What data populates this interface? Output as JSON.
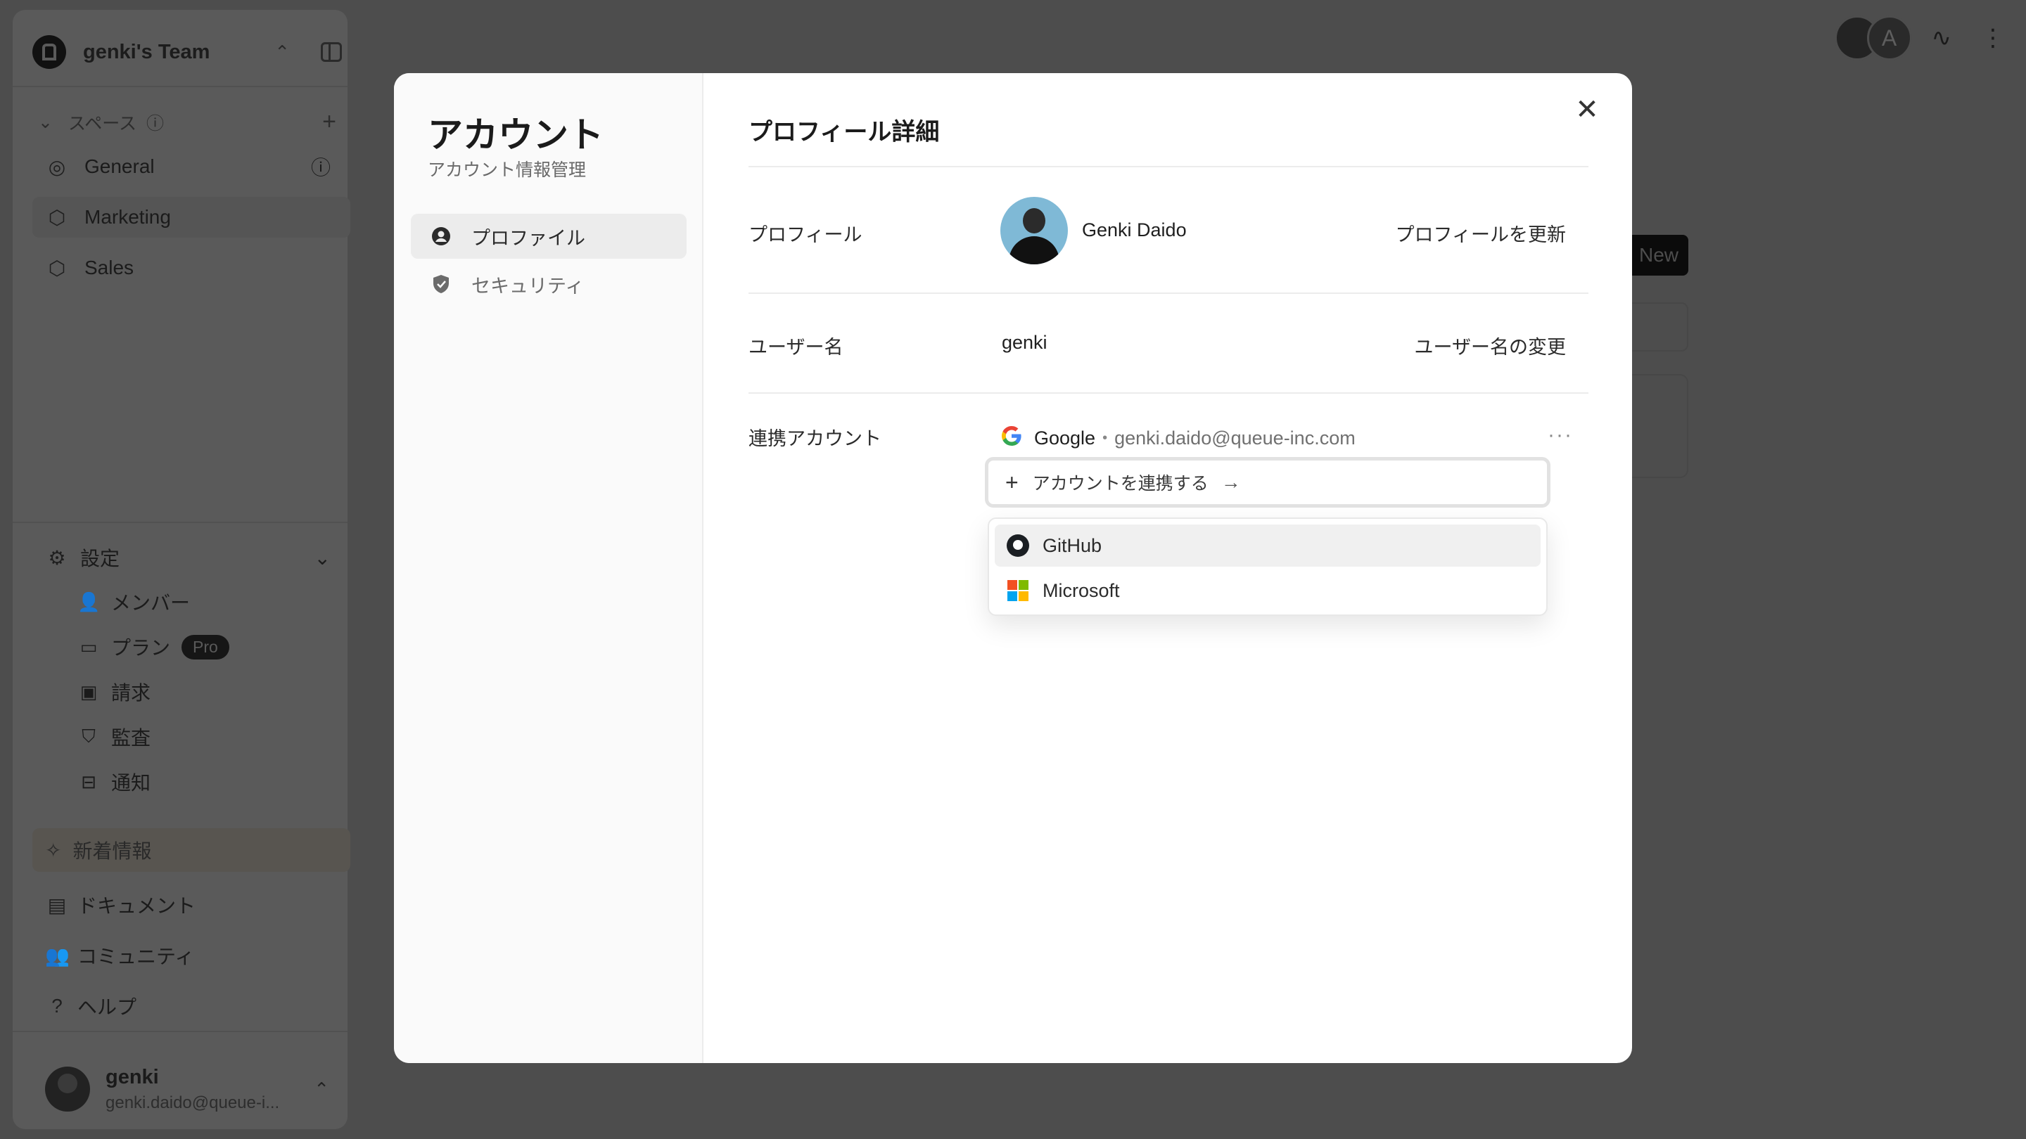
{
  "sidebar": {
    "team_name": "genki's Team",
    "spaces_label": "スペース",
    "spaces": [
      {
        "label": "General",
        "icon": "globe-icon"
      },
      {
        "label": "Marketing",
        "icon": "cube-icon",
        "active": true
      },
      {
        "label": "Sales",
        "icon": "cube-icon"
      }
    ],
    "settings_label": "設定",
    "settings_items": [
      {
        "label": "メンバー",
        "icon": "user-plus-icon"
      },
      {
        "label": "プラン",
        "icon": "wallet-icon",
        "badge": "Pro"
      },
      {
        "label": "請求",
        "icon": "banknote-icon"
      },
      {
        "label": "監査",
        "icon": "shield-icon"
      },
      {
        "label": "通知",
        "icon": "inbox-icon"
      }
    ],
    "whats_new": "新着情報",
    "links": [
      {
        "label": "ドキュメント",
        "icon": "document-icon"
      },
      {
        "label": "コミュニティ",
        "icon": "users-icon"
      },
      {
        "label": "ヘルプ",
        "icon": "help-icon"
      }
    ],
    "user": {
      "name": "genki",
      "email": "genki.daido@queue-i..."
    }
  },
  "topbar": {
    "avatar_letter": "A"
  },
  "background": {
    "new_button": "New"
  },
  "modal": {
    "title": "アカウント",
    "subtitle": "アカウント情報管理",
    "tabs": [
      {
        "label": "プロファイル",
        "icon": "user-circle-icon",
        "active": true
      },
      {
        "label": "セキュリティ",
        "icon": "shield-check-icon",
        "active": false
      }
    ],
    "section_title": "プロフィール詳細",
    "profile": {
      "label": "プロフィール",
      "name": "Genki Daido",
      "action": "プロフィールを更新"
    },
    "username": {
      "label": "ユーザー名",
      "value": "genki",
      "action": "ユーザー名の変更"
    },
    "linked_accounts": {
      "label": "連携アカウント",
      "provider": "Google",
      "email": "genki.daido@queue-inc.com",
      "connect_label": "アカウントを連携する",
      "options": [
        {
          "label": "GitHub",
          "icon": "github-icon"
        },
        {
          "label": "Microsoft",
          "icon": "microsoft-icon"
        }
      ]
    }
  },
  "colors": {
    "overlay_bg": "#4d4d4d",
    "modal_bg": "#ffffff",
    "microsoft": [
      "#f25022",
      "#7fba00",
      "#00a4ef",
      "#ffb900"
    ]
  }
}
